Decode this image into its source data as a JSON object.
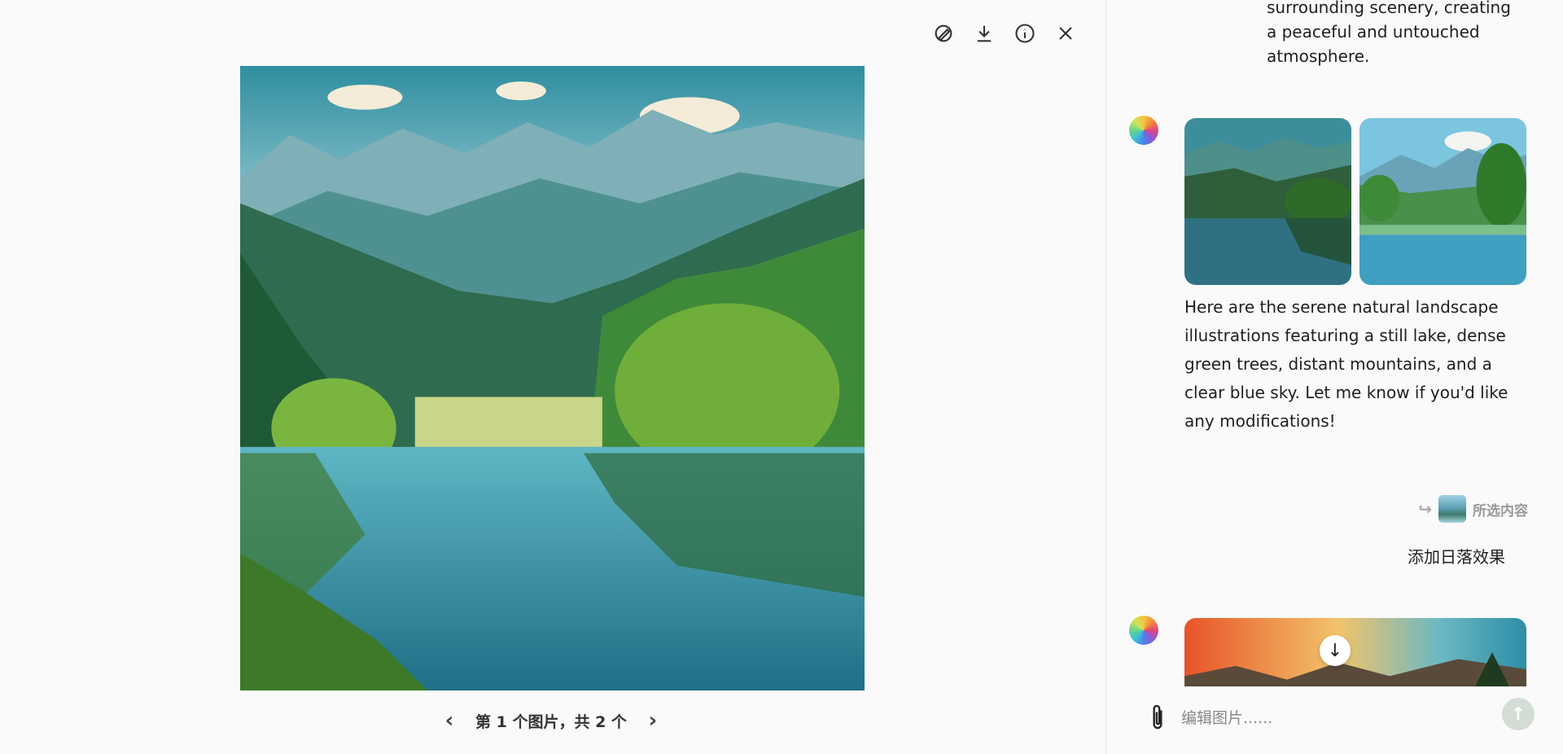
{
  "viewer": {
    "toolbar": {
      "edit_icon": "brush-edit-icon",
      "download_icon": "download-icon",
      "info_icon": "info-icon",
      "close_icon": "close-icon"
    },
    "pager": {
      "prev": "‹",
      "label": "第 1 个图片，共 2 个",
      "next": "›"
    }
  },
  "chat": {
    "prev_text": "surrounding scenery, creating a peaceful and untouched atmosphere.",
    "reply": "Here are the serene natural landscape illustrations featuring a still lake, dense green trees, distant mountains, and a clear blue sky. Let me know if you'd like any modifications!",
    "quote": {
      "arrow": "↪",
      "label": "所选内容"
    },
    "user_message": "添加日落效果",
    "scroll_down": "↓",
    "composer": {
      "placeholder": "编辑图片......",
      "send": "↑"
    }
  }
}
